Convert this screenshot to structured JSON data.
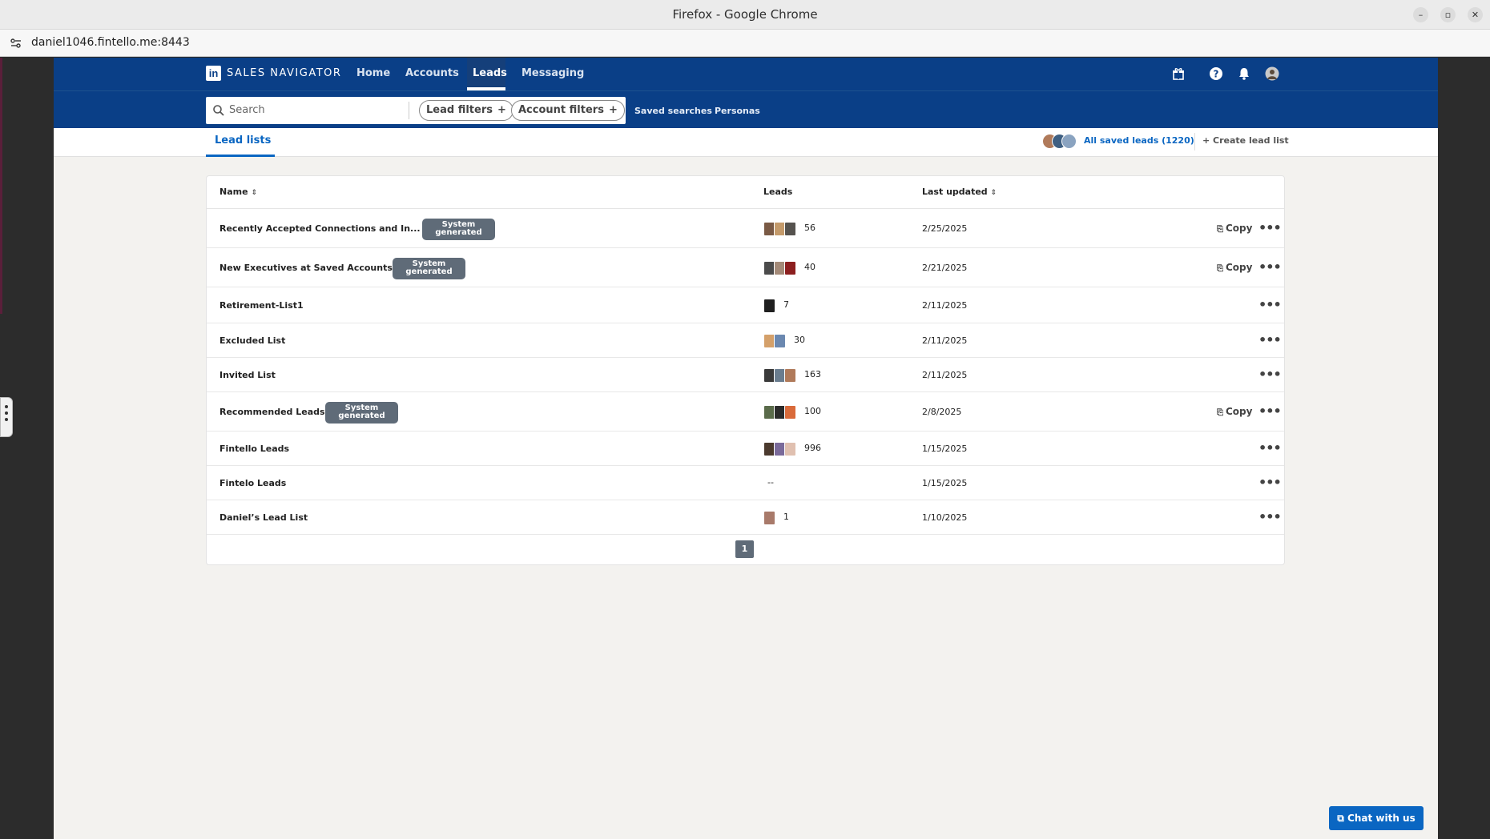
{
  "window": {
    "title": "Firefox - Google Chrome",
    "url": "daniel1046.fintello.me:8443"
  },
  "nav": {
    "brand": "SALES NAVIGATOR",
    "items": [
      {
        "label": "Home"
      },
      {
        "label": "Accounts"
      },
      {
        "label": "Leads",
        "active": true
      },
      {
        "label": "Messaging"
      }
    ]
  },
  "search": {
    "placeholder": "Search",
    "lead_filters": "Lead filters",
    "account_filters": "Account filters",
    "saved_searches": "Saved searches",
    "personas": "Personas"
  },
  "tabs": {
    "lead_lists": "Lead lists",
    "all_saved_leads": "All saved leads (1220)",
    "create_lead_list": "Create lead list"
  },
  "table": {
    "headers": {
      "name": "Name",
      "leads": "Leads",
      "last_updated": "Last updated"
    },
    "badge_line1": "System",
    "badge_line2": "generated",
    "copy_label": "Copy",
    "rows": [
      {
        "name": "Recently Accepted Connections and In...",
        "system": true,
        "leads": "56",
        "date": "2/25/2025",
        "copy": true
      },
      {
        "name": "New Executives at Saved Accounts",
        "system": true,
        "leads": "40",
        "date": "2/21/2025",
        "copy": true
      },
      {
        "name": "Retirement-List1",
        "system": false,
        "leads": "7",
        "date": "2/11/2025",
        "copy": false
      },
      {
        "name": "Excluded List",
        "system": false,
        "leads": "30",
        "date": "2/11/2025",
        "copy": false
      },
      {
        "name": "Invited List",
        "system": false,
        "leads": "163",
        "date": "2/11/2025",
        "copy": false
      },
      {
        "name": "Recommended Leads",
        "system": true,
        "leads": "100",
        "date": "2/8/2025",
        "copy": true
      },
      {
        "name": "Fintello Leads",
        "system": false,
        "leads": "996",
        "date": "1/15/2025",
        "copy": false
      },
      {
        "name": "Fintelo Leads",
        "system": false,
        "leads": "--",
        "date": "1/15/2025",
        "copy": false
      },
      {
        "name": "Daniel’s Lead List",
        "system": false,
        "leads": "1",
        "date": "1/10/2025",
        "copy": false
      }
    ]
  },
  "pagination": {
    "current": "1"
  },
  "chat": {
    "label": "Chat with us"
  },
  "colors": {
    "nav": "#0a3f87",
    "accent": "#0a66c2",
    "badge": "#5f6b78"
  }
}
